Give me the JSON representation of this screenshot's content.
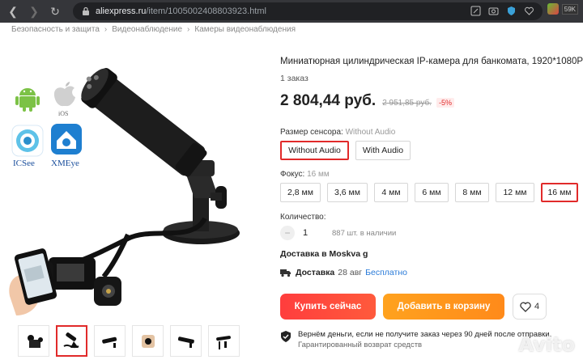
{
  "browser": {
    "url_domain": "aliexpress.ru",
    "url_path": "/item/1005002408803923.html",
    "extension_badge": "59K"
  },
  "breadcrumb": [
    "Безопасность и защита",
    "Видеонаблюдение",
    "Камеры видеонаблюдения"
  ],
  "gallery": {
    "badges": [
      "ICSee",
      "XMEye"
    ],
    "ios_text": "iOS",
    "thumbnail_count": 6,
    "selected_thumbnail": 2
  },
  "product": {
    "title": "Миниатюрная цилиндрическая IP-камера для банкомата, 1920*1080P",
    "orders": "1 заказ",
    "price": "2 804,44 руб.",
    "old_price": "2 951,85 руб.",
    "discount": "-5%",
    "sensor": {
      "label": "Размер сенсора:",
      "selected": "Without Audio",
      "options": [
        "Without Audio",
        "With Audio"
      ]
    },
    "focus": {
      "label": "Фокус:",
      "selected": "16 мм",
      "options": [
        "2,8 мм",
        "3,6 мм",
        "4 мм",
        "6 мм",
        "8 мм",
        "12 мм",
        "16 мм"
      ]
    },
    "quantity": {
      "label": "Количество:",
      "minus": "−",
      "value": "1",
      "plus": "+",
      "stock": "887 шт. в наличии"
    },
    "delivery_to": "Доставка в Moskva g",
    "shipping": {
      "label": "Доставка",
      "date": "28 авг",
      "free": "Бесплатно"
    },
    "buy_now": "Купить сейчас",
    "add_to_cart": "Добавить в корзину",
    "wishlist_count": "4",
    "guarantee_line1": "Вернём деньги, если не получите заказ через 90 дней после отправки.",
    "guarantee_line2": "Гарантированный возврат средств"
  },
  "watermark": "Avito",
  "colors": {
    "accent_red": "#e12a2a",
    "buy_button": "#ff3d3d",
    "cart_button": "#ffa21e",
    "link_blue": "#2a7bd8"
  }
}
